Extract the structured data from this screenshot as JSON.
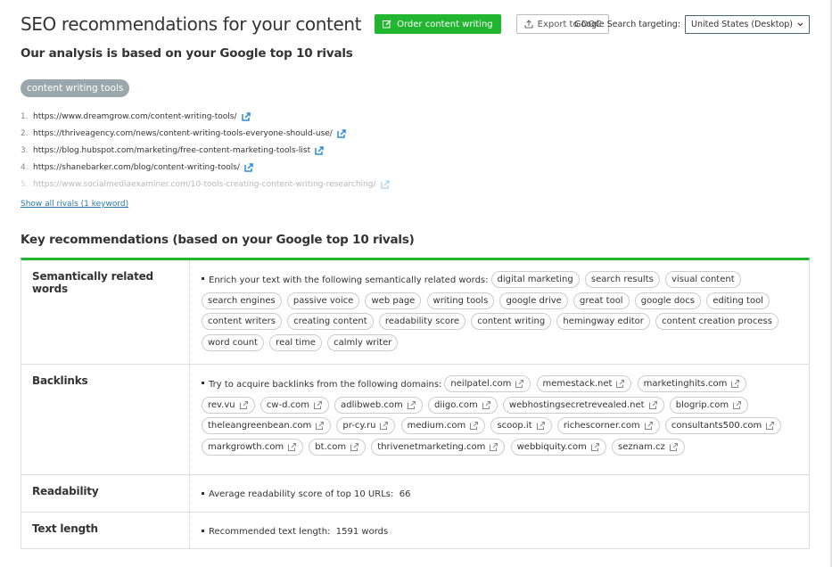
{
  "header": {
    "title": "SEO recommendations for your content",
    "order_button": "Order content writing",
    "export_button": "Export to DOC",
    "targeting_label": "Google Search targeting:",
    "targeting_value": "United States (Desktop)"
  },
  "subtitle": "Our analysis is based on your Google top 10 rivals",
  "keyword": "content writing tools",
  "rivals": [
    {
      "num": "1.",
      "url": "https://www.dreamgrow.com/content-writing-tools/"
    },
    {
      "num": "2.",
      "url": "https://thriveagency.com/news/content-writing-tools-everyone-should-use/"
    },
    {
      "num": "3.",
      "url": "https://blog.hubspot.com/marketing/free-content-marketing-tools-list"
    },
    {
      "num": "4.",
      "url": "https://shanebarker.com/blog/content-writing-tools/"
    },
    {
      "num": "5.",
      "url": "https://www.socialmediaexaminer.com/10-tools-creating-content-writing-researching/"
    }
  ],
  "show_all_link": "Show all rivals (1 keyword)",
  "section_title": "Key recommendations (based on your Google top 10 rivals)",
  "colors": {
    "accent_green": "#21b530",
    "link_blue": "#2a7ab0",
    "pill_gray": "#9aa8ad"
  },
  "recommendations": {
    "semantic": {
      "label": "Semantically related words",
      "intro": "Enrich your text with the following semantically related words:",
      "words": [
        "digital marketing",
        "search results",
        "visual content",
        "search engines",
        "passive voice",
        "web page",
        "writing tools",
        "google drive",
        "great tool",
        "google docs",
        "editing tool",
        "content writers",
        "creating content",
        "readability score",
        "content writing",
        "hemingway editor",
        "content creation process",
        "word count",
        "real time",
        "calmly writer"
      ]
    },
    "backlinks": {
      "label": "Backlinks",
      "intro": "Try to acquire backlinks from the following domains:",
      "domains": [
        "neilpatel.com",
        "memestack.net",
        "marketinghits.com",
        "rev.vu",
        "cw-d.com",
        "adlibweb.com",
        "diigo.com",
        "webhostingsecretrevealed.net",
        "blogrip.com",
        "theleangreenbean.com",
        "pr-cy.ru",
        "medium.com",
        "scoop.it",
        "richescorner.com",
        "consultants500.com",
        "markgrowth.com",
        "bt.com",
        "thrivenetmarketing.com",
        "webbiquity.com",
        "seznam.cz"
      ]
    },
    "readability": {
      "label": "Readability",
      "text": "Average readability score of top 10 URLs:",
      "value": "66"
    },
    "text_length": {
      "label": "Text length",
      "text": "Recommended text length:",
      "value": "1591 words"
    }
  }
}
